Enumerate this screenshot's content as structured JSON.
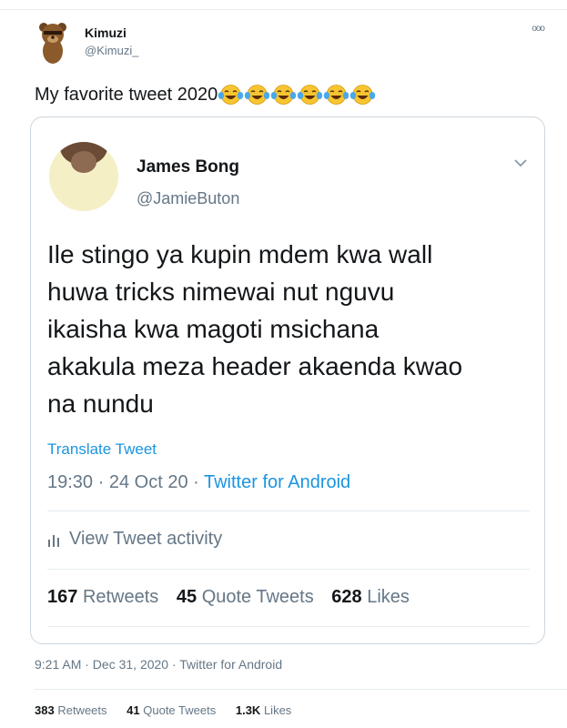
{
  "outer_tweet": {
    "name": "Kimuzi",
    "handle": "@Kimuzi_",
    "text": "My favorite tweet 2020",
    "emoji_count": 6,
    "meta": "9:21 AM · Dec 31, 2020 · Twitter for Android",
    "stats": {
      "retweets_count": "383",
      "retweets_label": "Retweets",
      "quotes_count": "41",
      "quotes_label": "Quote Tweets",
      "likes_count": "1.3K",
      "likes_label": "Likes"
    }
  },
  "quoted_tweet": {
    "name": "James Bong",
    "handle": "@JamieButon",
    "lines": [
      "Ile stingo ya kupin mdem kwa wall",
      "huwa tricks nimewai nut nguvu",
      "ikaisha kwa magoti msichana",
      "akakula meza header akaenda kwao",
      "na nundu"
    ],
    "translate_label": "Translate Tweet",
    "time": "19:30",
    "date": "24 Oct 20",
    "source": "Twitter for Android",
    "activity_label": "View Tweet activity",
    "stats": {
      "retweets_count": "167",
      "retweets_label": "Retweets",
      "quotes_count": "45",
      "quotes_label": "Quote Tweets",
      "likes_count": "628",
      "likes_label": "Likes"
    }
  },
  "colors": {
    "link": "#1b95e0",
    "muted": "#657786",
    "text": "#14171a",
    "border": "#ccd6dd"
  },
  "icons": [
    "bear-avatar",
    "more-icon",
    "joy-emoji",
    "chevron-down-icon",
    "bar-chart-icon"
  ]
}
